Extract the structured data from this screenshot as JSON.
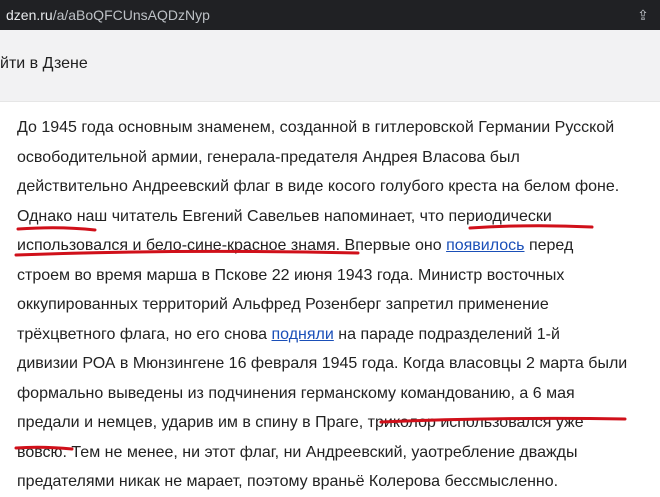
{
  "browser": {
    "url_domain": "dzen.ru",
    "url_path": "/a/aBoQFCUnsAQDzNyp"
  },
  "login_bar": {
    "label": "йти в Дзене"
  },
  "article": {
    "l1": "До 1945 года основным знаменем, созданной в гитлеровской Германии Русской",
    "l2": "освободительной армии, генерала-предателя Андрея Власова был",
    "l3": "действительно Андреевский флаг в виде косого голубого креста на белом фоне.",
    "l4": "Однако наш читатель Евгений Савельев напоминает, что периодически",
    "l5a": "использовался и бело-сине-красное знамя. Впервые оно ",
    "l5_link": "появилось",
    "l5b": " перед",
    "l6": "строем во время марша в Пскове 22 июня 1943 года. Министр восточных",
    "l7": "оккупированных территорий Альфред Розенберг запретил применение",
    "l8a": "трёхцветного флага, но его снова ",
    "l8_link": "подняли",
    "l8b": " на параде подразделений 1-й",
    "l9": "дивизии РОА в Мюнзингене 16 февраля 1945 года. Когда власовцы 2 марта были",
    "l10": "формально выведены из подчинения германскому командованию, а 6 мая",
    "l11": "предали и немцев, ударив им в спину в Праге, триколор использовался уже",
    "l12": "вовсю. Тем не менее, ни этот флаг, ни Андреевский, уаотребление дважды",
    "l13": "предателями никак не марает, поэтому враньё Колерова бессмысленно."
  },
  "colors": {
    "annotation": "#d0101a",
    "link": "#1a4fb8"
  }
}
